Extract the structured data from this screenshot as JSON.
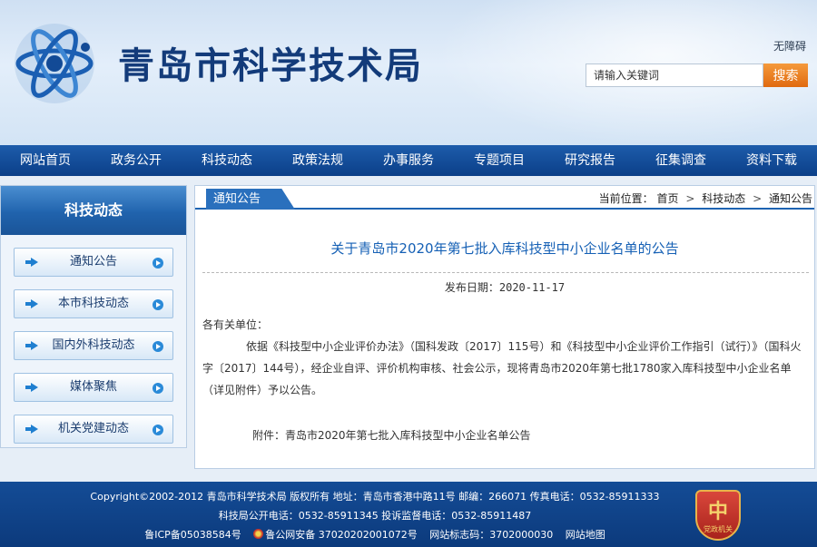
{
  "header": {
    "site_title": "青岛市科学技术局",
    "accessibility_label": "无障碍",
    "search_placeholder": "请输入关键词",
    "search_button": "搜索"
  },
  "nav": {
    "items": [
      "网站首页",
      "政务公开",
      "科技动态",
      "政策法规",
      "办事服务",
      "专题项目",
      "研究报告",
      "征集调查",
      "资料下载"
    ]
  },
  "sidebar": {
    "title": "科技动态",
    "items": [
      "通知公告",
      "本市科技动态",
      "国内外科技动态",
      "媒体聚焦",
      "机关党建动态"
    ]
  },
  "main": {
    "tab_label": "通知公告",
    "breadcrumb": {
      "prefix": "当前位置：",
      "items": [
        "首页",
        "科技动态",
        "通知公告"
      ],
      "separator": ">"
    },
    "article": {
      "title": "关于青岛市2020年第七批入库科技型中小企业名单的公告",
      "pubdate": "发布日期：2020-11-17",
      "salutation": "各有关单位：",
      "paragraph": "依据《科技型中小企业评价办法》（国科发政〔2017〕115号）和《科技型中小企业评价工作指引（试行）》（国科火字〔2017〕144号），经企业自评、评价机构审核、社会公示，现将青岛市2020年第七批1780家入库科技型中小企业名单（详见附件）予以公告。",
      "attachment": "附件：青岛市2020年第七批入库科技型中小企业名单公告"
    }
  },
  "footer": {
    "line1": "Copyright©2002-2012 青岛市科学技术局 版权所有 地址：青岛市香港中路11号 邮编：266071 传真电话：0532-85911333",
    "line2": "科技局公开电话：0532-85911345 投诉监督电话：0532-85911487",
    "icp": "鲁ICP备05038584号",
    "police": "鲁公网安备 37020202001072号",
    "site_code": "网站标志码：3702000030",
    "sitemap": "网站地图",
    "badge_glyph": "中",
    "badge_text": "党政机关"
  },
  "colors": {
    "nav_bg": "#0b3f88",
    "title_blue": "#1560b5",
    "search_orange": "#e06a10",
    "footer_bg": "#0c3a7c"
  }
}
